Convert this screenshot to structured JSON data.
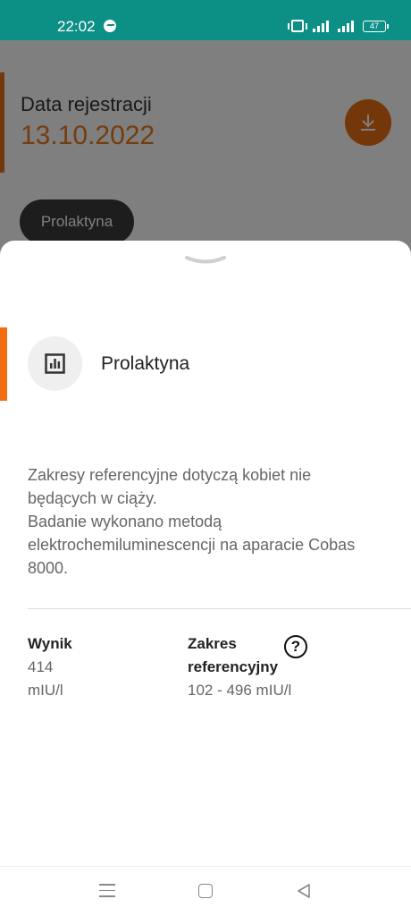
{
  "status_bar": {
    "time": "22:02",
    "battery": "47",
    "icons": [
      "messenger-icon",
      "vibrate-icon",
      "signal-icon",
      "battery-icon"
    ]
  },
  "background": {
    "registration_label": "Data rejestracji",
    "registration_date": "13.10.2022",
    "chip_label": "Prolaktyna",
    "download_icon": "download-icon",
    "accent_color": "#e8701a"
  },
  "sheet": {
    "title": "Prolaktyna",
    "title_icon": "bar-chart-icon",
    "description_lines": [
      "Zakresy referencyjne dotyczą kobiet nie",
      "będących w ciąży.",
      "Badanie wykonano metodą",
      "elektrochemiluminescencji na aparacie Cobas",
      "8000."
    ],
    "result": {
      "label": "Wynik",
      "value": "414",
      "unit": "mIU/l"
    },
    "reference": {
      "label_line1": "Zakres",
      "label_line2": "referencyjny",
      "value": "102 - 496 mIU/l",
      "help_glyph": "?"
    }
  },
  "nav_bar": {
    "icons": [
      "menu-icon",
      "home-icon",
      "back-icon"
    ]
  },
  "colors": {
    "status_bar": "#0c8f84",
    "accent": "#f26d0f"
  }
}
